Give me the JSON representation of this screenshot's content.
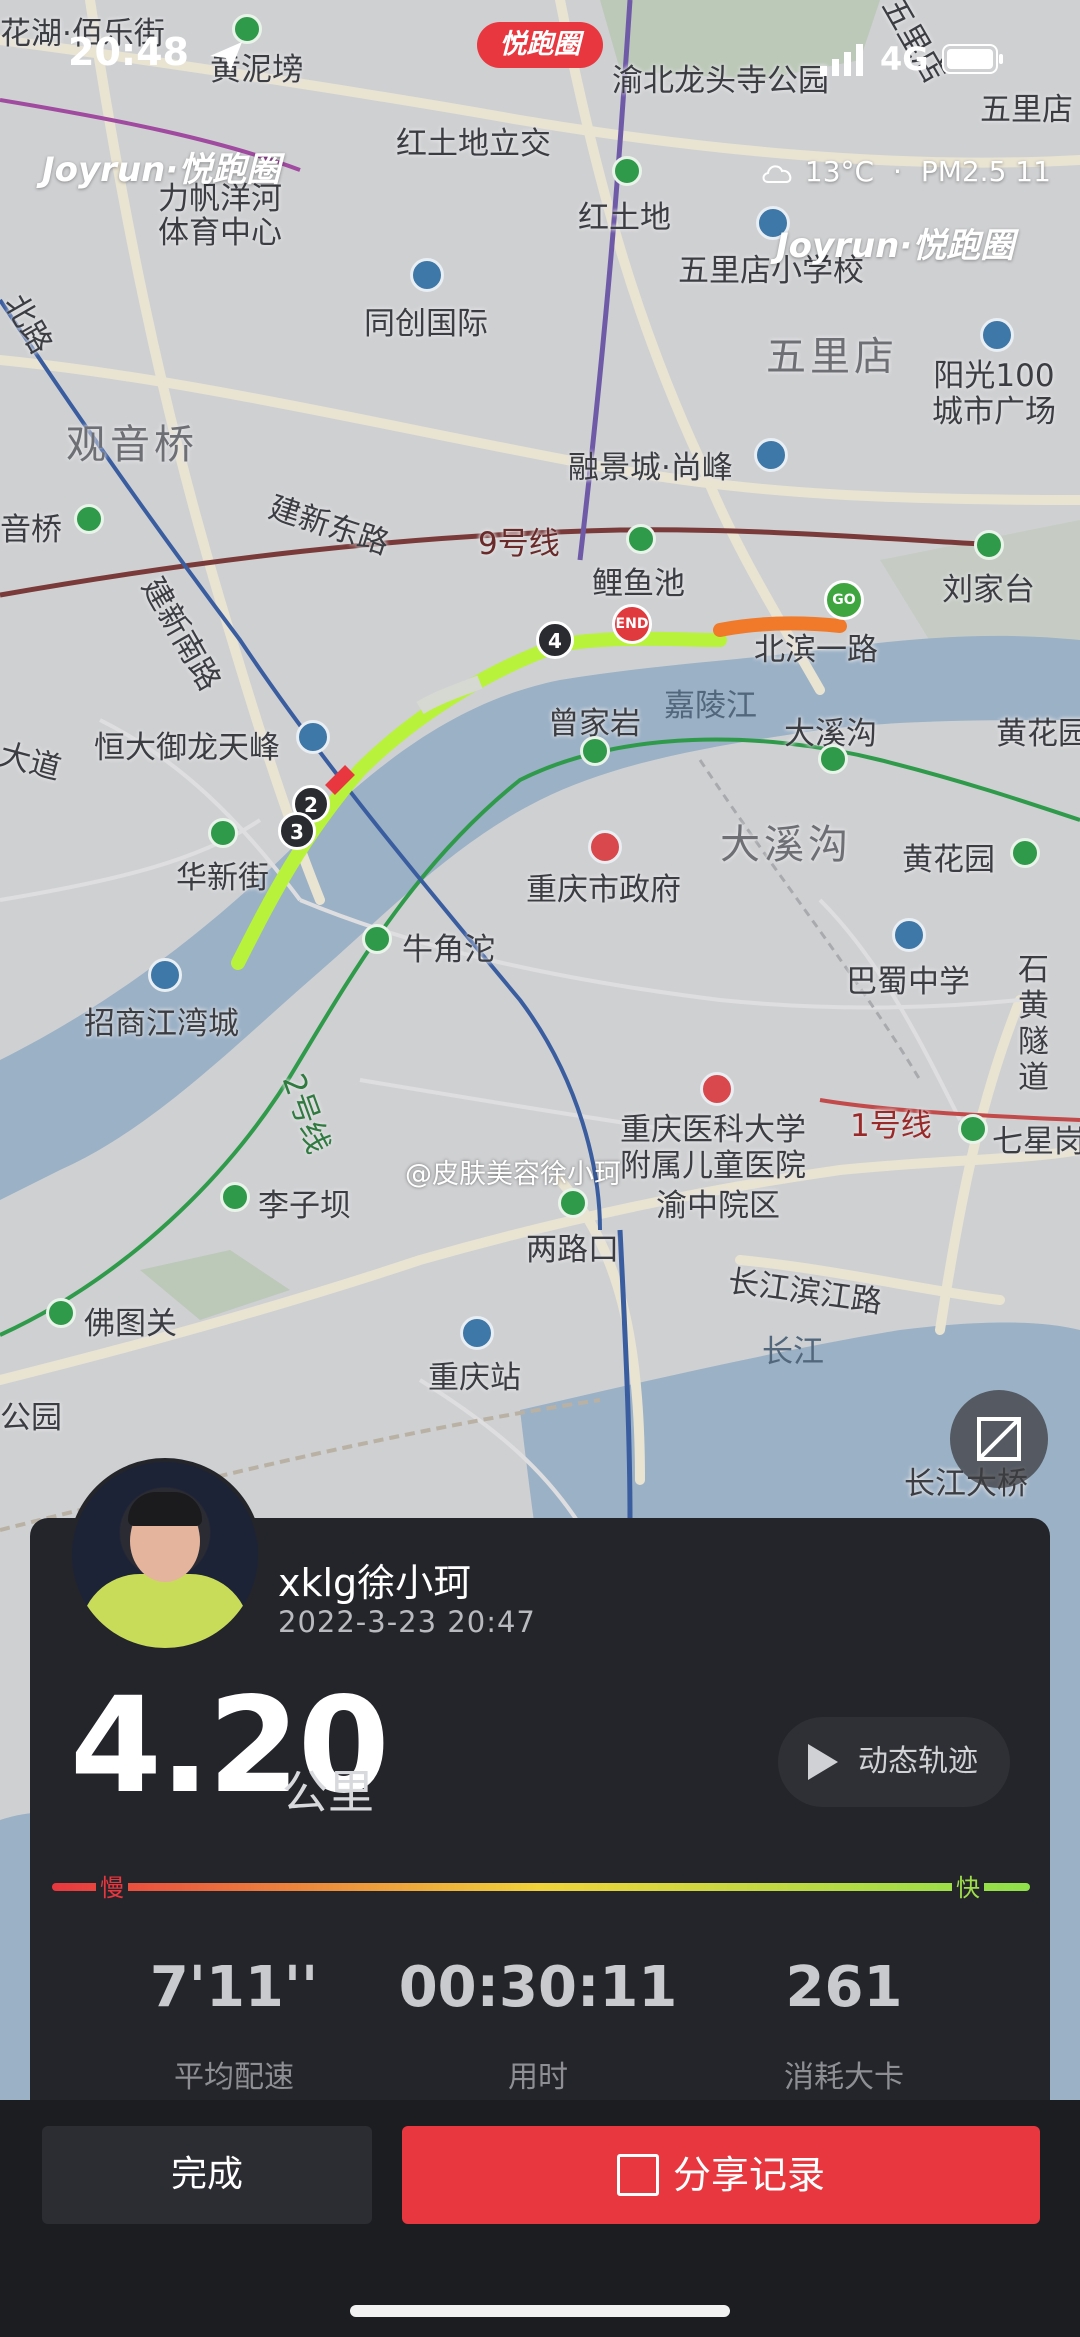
{
  "status_bar": {
    "time": "20:48",
    "network": "4G"
  },
  "brand": {
    "app_pill": "悦跑圈",
    "logo_left": "Joyrun·悦跑圈",
    "logo_right": "Joyrun·悦跑圈"
  },
  "weather": {
    "temp": "13°C",
    "separator": "·",
    "aqi": "PM2.5 11"
  },
  "map_labels": {
    "l1": "花湖·佰乐街",
    "l2": "黄泥塝",
    "l3": "渝北龙头寺公园",
    "l4": "五里店",
    "l5": "红土地立交",
    "l6": "力帆洋河\n体育中心",
    "l7": "红土地",
    "l8": "五里店小学校",
    "l9": "同创国际",
    "l10": "五里店",
    "l11": "阳光100\n城市广场",
    "l12": "观音桥",
    "l13": "融景城·尚峰",
    "l14": "建新东路",
    "l15": "9号线",
    "l16": "音桥",
    "l17": "鲤鱼池",
    "l18": "刘家台",
    "l19": "北滨一路",
    "l20": "建新南路",
    "l21": "曾家岩",
    "l22": "嘉陵江",
    "l23": "大溪沟",
    "l24": "黄花园",
    "l25": "恒大御龙天峰",
    "l26": "大溪沟",
    "l27": "重庆市政府",
    "l28": "黄花园",
    "l29": "华新街",
    "l30": "牛角沱",
    "l31": "巴蜀中学",
    "l32": "招商江湾城",
    "l33": "石\n黄\n隧\n道",
    "l34": "重庆医科大学\n附属儿童医院",
    "l35": "1号线",
    "l36": "七星岗",
    "l37": "渝中院区",
    "l38": "李子坝",
    "l39": "两路口",
    "l40": "长江滨江路",
    "l41": "佛图关",
    "l42": "长江",
    "l43": "重庆站",
    "l44": "长江大桥",
    "l45": "公园",
    "l46": "2号线",
    "l47": "大道",
    "l48": "北路",
    "l49": "五里店"
  },
  "watermark": "@皮肤美容徐小珂",
  "route_markers": {
    "m2": "2",
    "m3": "3",
    "m4": "4",
    "go": "GO",
    "end": "END"
  },
  "run": {
    "username": "xklg徐小珂",
    "datetime": "2022-3-23 20:47",
    "distance": "4.20",
    "unit": "公里",
    "replay_label": "动态轨迹",
    "speed_slow": "慢",
    "speed_fast": "快",
    "stats": [
      {
        "value": "7'11''",
        "label": "平均配速"
      },
      {
        "value": "00:30:11",
        "label": "用时"
      },
      {
        "value": "261",
        "label": "消耗大卡"
      }
    ]
  },
  "actions": {
    "done": "完成",
    "share": "分享记录"
  },
  "colors": {
    "accent": "#e8373f",
    "route": "#b8f23a",
    "route_start": "#f07a2a",
    "river": "#9bb1c6"
  }
}
